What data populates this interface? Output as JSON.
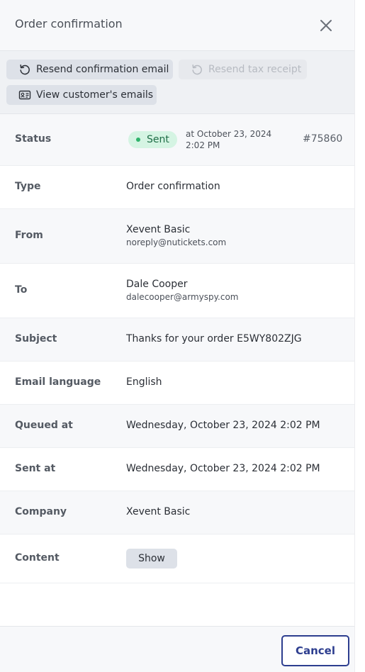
{
  "header": {
    "title": "Order confirmation",
    "close_icon": "close-icon"
  },
  "toolbar": {
    "resend_confirmation": {
      "label": "Resend confirmation email",
      "icon": "refresh-icon",
      "enabled": true
    },
    "resend_tax_receipt": {
      "label": "Resend tax receipt",
      "icon": "refresh-icon",
      "enabled": false
    },
    "view_emails": {
      "label": "View customer's emails",
      "icon": "id-card-icon",
      "enabled": true
    }
  },
  "details": {
    "status": {
      "label": "Status",
      "badge": "Sent",
      "badge_color": "#d5f4e3",
      "dot_color": "#2fb36b",
      "time": "at October 23, 2024 2:02 PM",
      "order_number": "#75860"
    },
    "type": {
      "label": "Type",
      "value": "Order confirmation"
    },
    "from": {
      "label": "From",
      "name": "Xevent Basic",
      "email": "noreply@nutickets.com"
    },
    "to": {
      "label": "To",
      "name": "Dale Cooper",
      "email": "dalecooper@armyspy.com"
    },
    "subject": {
      "label": "Subject",
      "value": "Thanks for your order E5WY802ZJG"
    },
    "language": {
      "label": "Email language",
      "value": "English"
    },
    "queued_at": {
      "label": "Queued at",
      "value": "Wednesday, October 23, 2024 2:02 PM"
    },
    "sent_at": {
      "label": "Sent at",
      "value": "Wednesday, October 23, 2024 2:02 PM"
    },
    "company": {
      "label": "Company",
      "value": "Xevent Basic"
    },
    "content": {
      "label": "Content",
      "button": "Show"
    }
  },
  "footer": {
    "cancel_label": "Cancel",
    "accent": "#2d3e8f"
  }
}
